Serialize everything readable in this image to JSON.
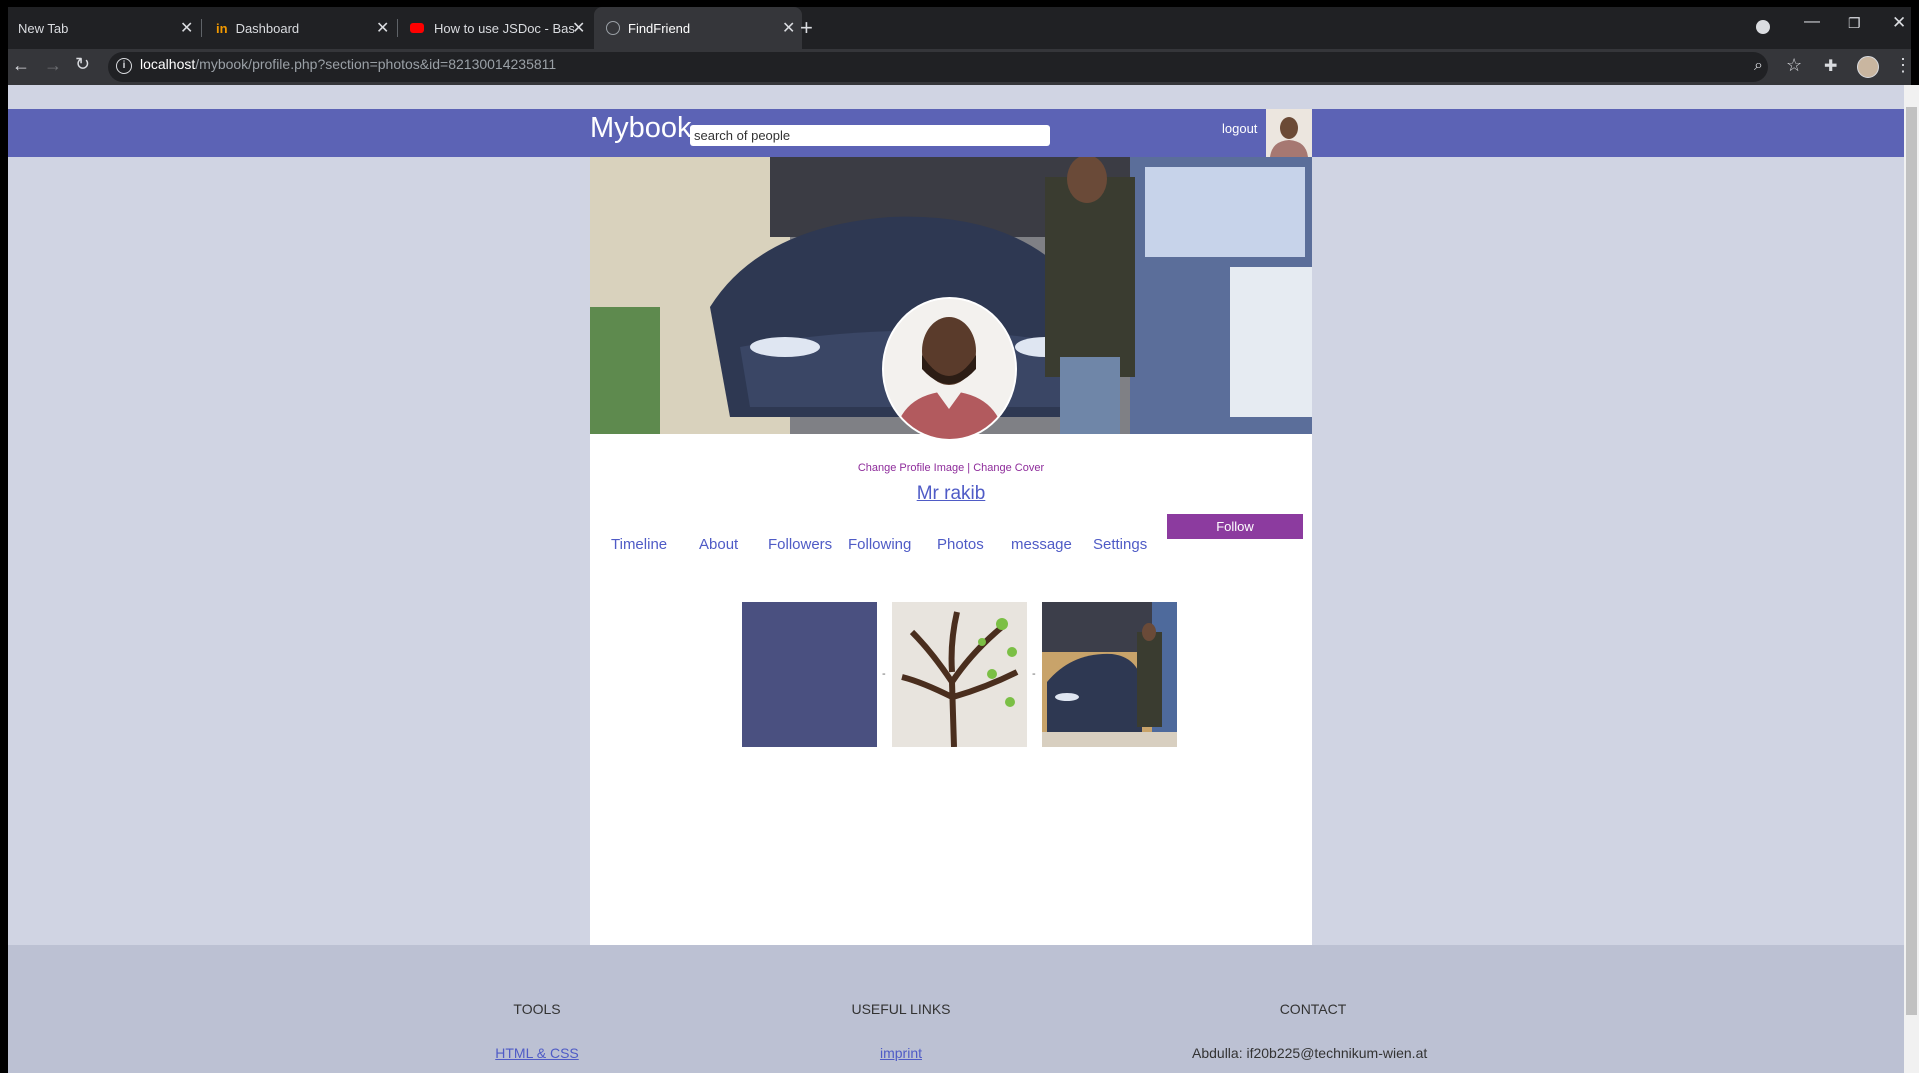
{
  "browser": {
    "tabs": [
      {
        "label": "New Tab",
        "active": false
      },
      {
        "label": "Dashboard",
        "active": false
      },
      {
        "label": "How to use JSDoc - Basics & Intro",
        "active": false
      },
      {
        "label": "FindFriend",
        "active": true
      }
    ],
    "new_tab_label": "+",
    "url_host": "localhost",
    "url_path": "/mybook/profile.php?section=photos&id=82130014235811"
  },
  "header": {
    "logo": "Mybook",
    "search_placeholder": "search of people",
    "logout_label": "logout"
  },
  "profile": {
    "change_profile_image": "Change Profile Image",
    "separator": "|",
    "change_cover": "Change Cover",
    "name": "Mr rakib",
    "follow_label": "Follow",
    "nav": [
      "Timeline",
      "About",
      "Followers",
      "Following",
      "Photos",
      "message",
      "Settings"
    ]
  },
  "photos": {
    "separator": "-",
    "items": [
      "blue-square",
      "word-tree",
      "car-photo"
    ]
  },
  "footer": {
    "tools_heading": "TOOLS",
    "tools_link": "HTML & CSS",
    "links_heading": "USEFUL LINKS",
    "links_link": "imprint",
    "contact_heading": "CONTACT",
    "contact_text": "Abdulla: if20b225@technikum-wien.at"
  },
  "colors": {
    "header_bar": "#5c63b5",
    "page_bg": "#d0d4e3",
    "footer_bg": "#bcc1d3",
    "follow_button": "#8c3b9f",
    "link": "#4f5bc6",
    "photo_blue_square": "#4a5080"
  }
}
